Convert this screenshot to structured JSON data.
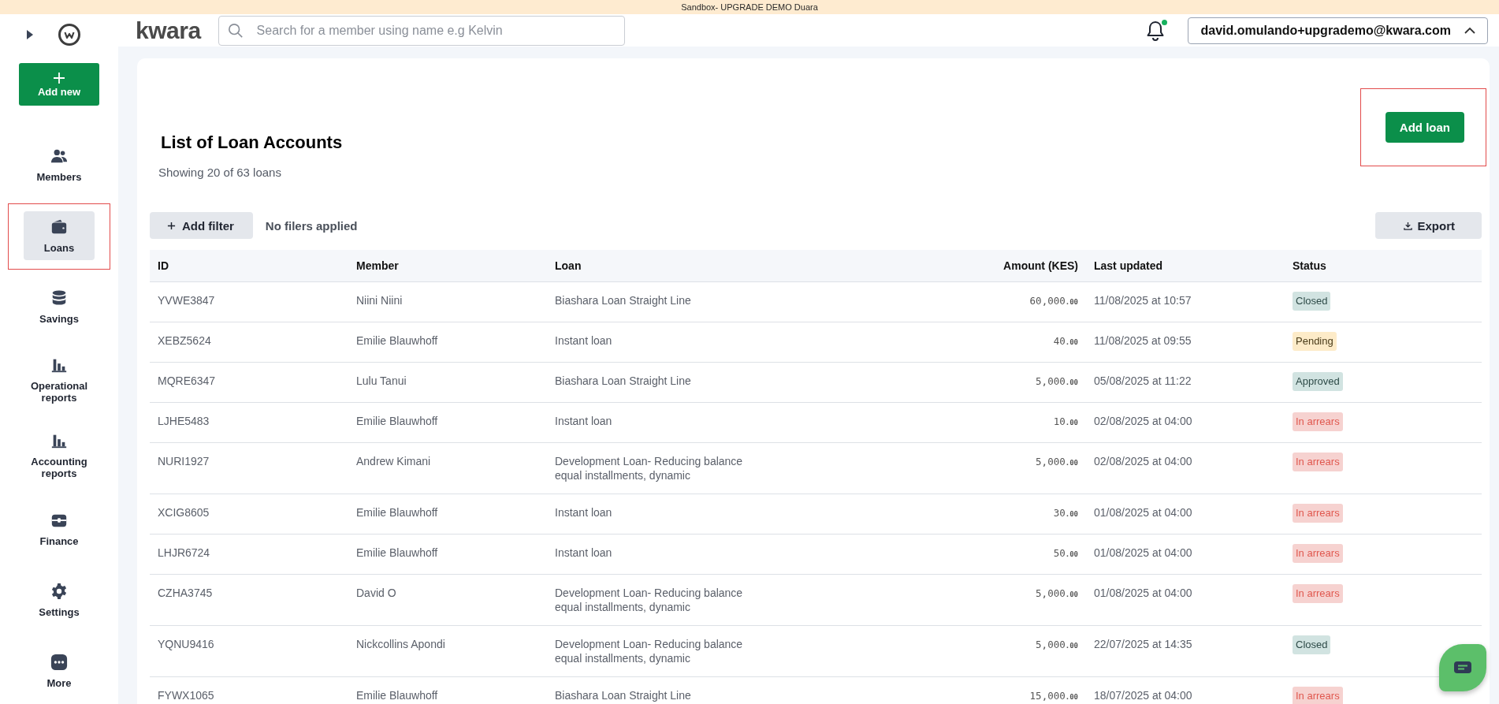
{
  "banner": {
    "text": "Sandbox- UPGRADE DEMO Duara"
  },
  "header": {
    "logo": "kwara",
    "search": {
      "placeholder": "Search for a member using name e.g Kelvin"
    },
    "notifications": {
      "unread": true
    },
    "account": {
      "email": "david.omulando+upgrademo@kwara.com",
      "expanded": true
    }
  },
  "sidebar": {
    "add_button": "Add new",
    "items": [
      {
        "kind": "members",
        "label": "Members",
        "selected": false,
        "highlighted": false
      },
      {
        "kind": "loans",
        "label": "Loans",
        "selected": true,
        "highlighted": true
      },
      {
        "kind": "savings",
        "label": "Savings",
        "selected": false,
        "highlighted": false
      },
      {
        "kind": "reports",
        "label": "Operational reports",
        "selected": false,
        "highlighted": false
      },
      {
        "kind": "reports",
        "label": "Accounting reports",
        "selected": false,
        "highlighted": false
      },
      {
        "kind": "finance",
        "label": "Finance",
        "selected": false,
        "highlighted": false
      },
      {
        "kind": "settings",
        "label": "Settings",
        "selected": false,
        "highlighted": false
      },
      {
        "kind": "more",
        "label": "More",
        "selected": false,
        "highlighted": false
      }
    ]
  },
  "page": {
    "title": "List of Loan Accounts",
    "subtitle": "Showing 20 of 63 loans",
    "add_loan": {
      "label": "Add loan",
      "highlighted": true
    },
    "filter_button": "Add filter",
    "filter_status": "No filers applied",
    "export_button": "Export"
  },
  "table": {
    "columns": [
      "ID",
      "Member",
      "Loan",
      "Amount (KES)",
      "Last updated",
      "Status"
    ],
    "rows": [
      {
        "id": "YVWE3847",
        "member": "Niini Niini",
        "loan": "Biashara Loan Straight Line",
        "amount": "60,000.00",
        "updated": "11/08/2025 at 10:57",
        "status": "Closed",
        "kind": "closed"
      },
      {
        "id": "XEBZ5624",
        "member": "Emilie Blauwhoff",
        "loan": "Instant loan",
        "amount": "40.00",
        "updated": "11/08/2025 at 09:55",
        "status": "Pending",
        "kind": "pending"
      },
      {
        "id": "MQRE6347",
        "member": "Lulu Tanui",
        "loan": "Biashara Loan Straight Line",
        "amount": "5,000.00",
        "updated": "05/08/2025 at 11:22",
        "status": "Approved",
        "kind": "approved"
      },
      {
        "id": "LJHE5483",
        "member": "Emilie Blauwhoff",
        "loan": "Instant loan",
        "amount": "10.00",
        "updated": "02/08/2025 at 04:00",
        "status": "In arrears",
        "kind": "arrears"
      },
      {
        "id": "NURI1927",
        "member": "Andrew Kimani",
        "loan": "Development Loan- Reducing balance equal installments, dynamic",
        "amount": "5,000.00",
        "updated": "02/08/2025 at 04:00",
        "status": "In arrears",
        "kind": "arrears"
      },
      {
        "id": "XCIG8605",
        "member": "Emilie Blauwhoff",
        "loan": "Instant loan",
        "amount": "30.00",
        "updated": "01/08/2025 at 04:00",
        "status": "In arrears",
        "kind": "arrears"
      },
      {
        "id": "LHJR6724",
        "member": "Emilie Blauwhoff",
        "loan": "Instant loan",
        "amount": "50.00",
        "updated": "01/08/2025 at 04:00",
        "status": "In arrears",
        "kind": "arrears"
      },
      {
        "id": "CZHA3745",
        "member": "David O",
        "loan": "Development Loan- Reducing balance equal installments, dynamic",
        "amount": "5,000.00",
        "updated": "01/08/2025 at 04:00",
        "status": "In arrears",
        "kind": "arrears"
      },
      {
        "id": "YQNU9416",
        "member": "Nickcollins Apondi",
        "loan": "Development Loan- Reducing balance equal installments, dynamic",
        "amount": "5,000.00",
        "updated": "22/07/2025 at 14:35",
        "status": "Closed",
        "kind": "closed"
      },
      {
        "id": "FYWX1065",
        "member": "Emilie Blauwhoff",
        "loan": "Biashara Loan Straight Line",
        "amount": "15,000.00",
        "updated": "18/07/2025 at 04:00",
        "status": "In arrears",
        "kind": "arrears"
      }
    ]
  }
}
